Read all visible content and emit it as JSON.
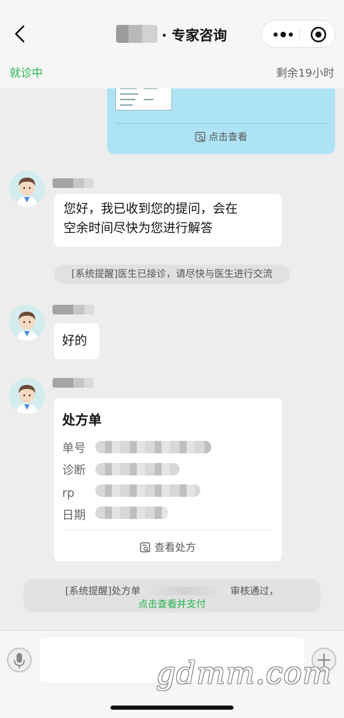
{
  "header": {
    "title": "· 专家咨询",
    "status_left": "就诊中",
    "status_right": "剩余19小时",
    "icons": {
      "back": "chevron-left-icon",
      "more": "more-dots-icon",
      "target": "mini-program-close-icon"
    }
  },
  "image_message": {
    "link_label": "点击查看"
  },
  "messages": [
    {
      "text_line1": "您好，我已收到您的提问，会在",
      "text_line2": "空余时间尽快为您进行解答"
    },
    {
      "text": "好的"
    }
  ],
  "system_notice_1": "[系统提醒]医生已接诊，请尽快与医生进行交流",
  "prescription": {
    "title": "处方单",
    "fields": [
      "单号",
      "诊断",
      "rp",
      "日期"
    ],
    "link_label": "查看处方"
  },
  "system_notice_2": {
    "prefix": "[系统提醒]处方单",
    "suffix": "审核通过，",
    "action": "点击查看并支付"
  },
  "input_bar": {
    "watermark": "gdmm.com",
    "icons": {
      "voice": "microphone-icon",
      "add": "plus-icon"
    }
  },
  "colors": {
    "accent_green": "#23b34e",
    "image_bubble": "#aee3f5"
  }
}
